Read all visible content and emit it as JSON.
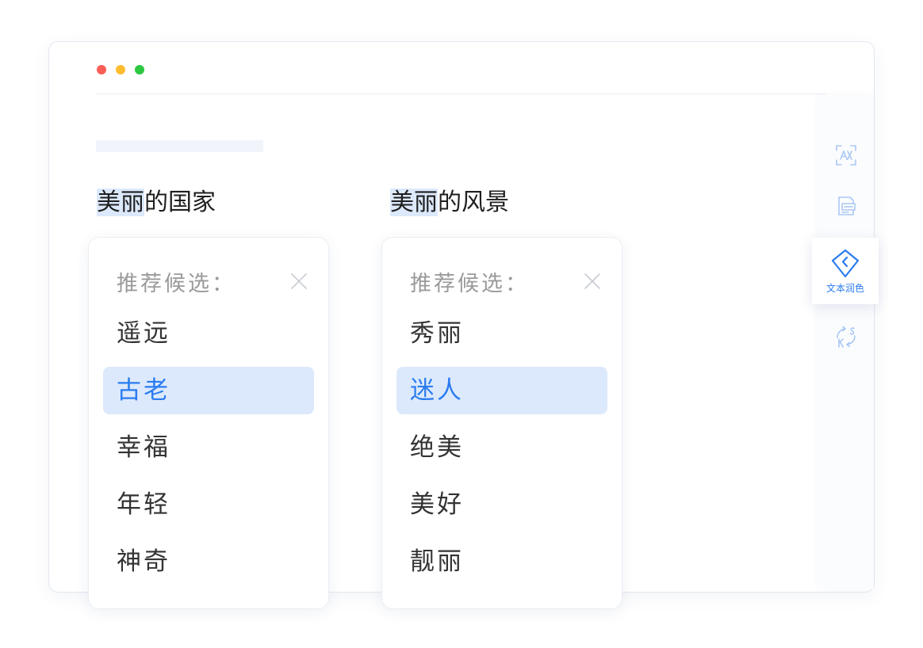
{
  "editor": {
    "phrases": [
      {
        "highlighted": "美丽",
        "rest": "的国家"
      },
      {
        "highlighted": "美丽",
        "rest": "的风景"
      }
    ]
  },
  "suggestion_cards": [
    {
      "header": "推荐候选：",
      "options": [
        "遥远",
        "古老",
        "幸福",
        "年轻",
        "神奇"
      ],
      "selected_index": 1
    },
    {
      "header": "推荐候选：",
      "options": [
        "秀丽",
        "迷人",
        "绝美",
        "美好",
        "靓丽"
      ],
      "selected_index": 1
    }
  ],
  "toolbar": {
    "tools": [
      {
        "icon": "text-recognition-icon"
      },
      {
        "icon": "document-list-icon"
      },
      {
        "icon": "text-polish-icon",
        "label": "文本润色",
        "active": true
      },
      {
        "icon": "sync-refresh-icon"
      }
    ]
  },
  "colors": {
    "accent": "#2a7cf0",
    "highlight": "#dce9fc",
    "icon_inactive": "#a9c8f3",
    "dot_red": "#fd5f57",
    "dot_yellow": "#febc2e",
    "dot_green": "#2bc840"
  }
}
